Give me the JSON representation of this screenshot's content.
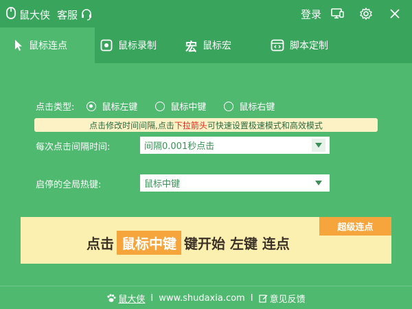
{
  "titlebar": {
    "app_name": "鼠大侠",
    "service_label": "客服",
    "login_label": "登录",
    "icons": [
      "mouse-logo-icon",
      "headset-icon",
      "monitor-icon",
      "gear-icon",
      "close-icon"
    ]
  },
  "tabs": [
    {
      "label": "鼠标连点",
      "icon": "cursor-icon",
      "active": true
    },
    {
      "label": "鼠标录制",
      "icon": "record-icon",
      "active": false
    },
    {
      "label": "鼠标宏",
      "icon": "macro-icon",
      "active": false
    },
    {
      "label": "脚本定制",
      "icon": "script-icon",
      "active": false
    }
  ],
  "click_type": {
    "label": "点击类型:",
    "options": [
      {
        "label": "鼠标左键",
        "selected": true
      },
      {
        "label": "鼠标中键",
        "selected": false
      },
      {
        "label": "鼠标右键",
        "selected": false
      }
    ]
  },
  "tip": {
    "before": "点击修改时间间隔,点击",
    "highlight": "下拉箭头",
    "after": "可快速设置极速模式和高效模式"
  },
  "interval": {
    "label": "每次点击间隔时间:",
    "value": "间隔0.001秒点击"
  },
  "hotkey": {
    "label": "启停的全局热键:",
    "value": "鼠标中键"
  },
  "banner": {
    "badge": "超级连点",
    "prefix": "点击",
    "key": "鼠标中键",
    "suffix": "键开始 左键 连点"
  },
  "footer": {
    "brand": "鼠大侠",
    "separator": "I",
    "site": "www.shudaxia.com",
    "feedback": "意见反馈"
  },
  "colors": {
    "background": "#4fb970",
    "header": "#39a45c",
    "tip_bg": "#fdf2c6",
    "tip_warn": "#e0281b",
    "banner_bg": "#fcf0b1",
    "accent_orange": "#f5a53b"
  }
}
